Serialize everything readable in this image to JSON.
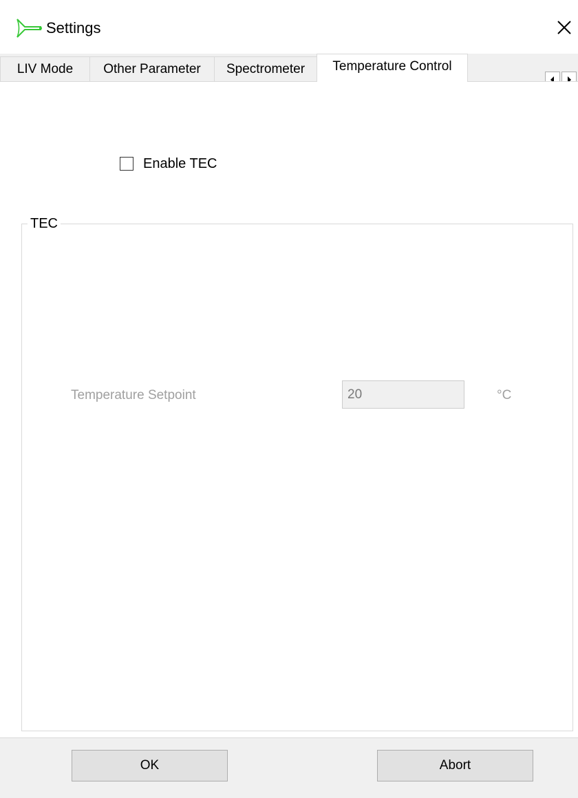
{
  "window": {
    "title": "Settings",
    "icon": "app-logo-icon",
    "close_icon": "close-icon"
  },
  "tabs": [
    {
      "label": "LIV Mode",
      "active": false
    },
    {
      "label": "Other Parameter",
      "active": false
    },
    {
      "label": "Spectrometer",
      "active": false
    },
    {
      "label": "Temperature Control",
      "active": true
    }
  ],
  "tab_scroll": {
    "left_icon": "scroll-left-icon",
    "right_icon": "scroll-right-icon"
  },
  "temperature_control": {
    "enable_tec": {
      "label": "Enable TEC",
      "checked": false
    },
    "tec_group": {
      "title": "TEC",
      "setpoint_label": "Temperature Setpoint",
      "setpoint_value": "20",
      "setpoint_unit": "°C",
      "enabled": false
    }
  },
  "buttons": {
    "ok_label": "OK",
    "abort_label": "Abort"
  },
  "colors": {
    "accent_icon": "#37c837",
    "disabled_text": "#a0a0a0"
  }
}
